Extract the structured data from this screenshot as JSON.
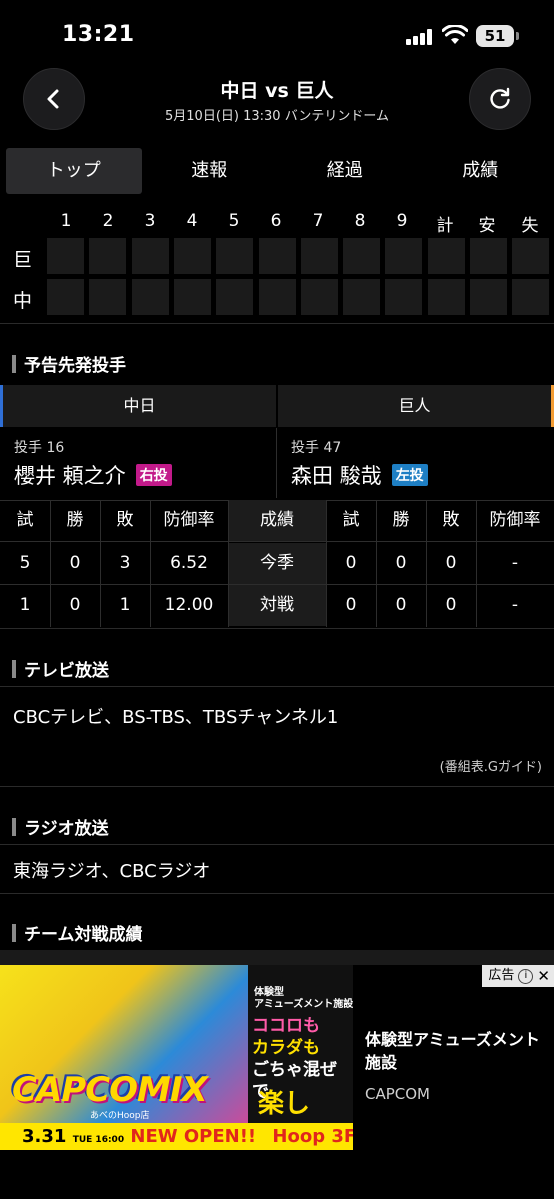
{
  "status": {
    "time": "13:21",
    "battery": "51"
  },
  "header": {
    "title": "中日 vs 巨人",
    "subtitle": "5月10日(日) 13:30 バンテリンドーム"
  },
  "tabs": [
    "トップ",
    "速報",
    "経過",
    "成績"
  ],
  "scoreboard": {
    "columns": [
      "1",
      "2",
      "3",
      "4",
      "5",
      "6",
      "7",
      "8",
      "9",
      "計",
      "安",
      "失"
    ],
    "teams": [
      "巨",
      "中"
    ]
  },
  "starters": {
    "section_title": "予告先発投手",
    "home": {
      "team": "中日",
      "number_label": "投手 16",
      "name": "櫻井 頼之介",
      "hand": "右投"
    },
    "away": {
      "team": "巨人",
      "number_label": "投手 47",
      "name": "森田 駿哉",
      "hand": "左投"
    },
    "headers": [
      "試",
      "勝",
      "敗",
      "防御率",
      "成績",
      "試",
      "勝",
      "敗",
      "防御率"
    ],
    "rows": [
      {
        "label": "今季",
        "home": [
          "5",
          "0",
          "3",
          "6.52"
        ],
        "away": [
          "0",
          "0",
          "0",
          "-"
        ]
      },
      {
        "label": "対戦",
        "home": [
          "1",
          "0",
          "1",
          "12.00"
        ],
        "away": [
          "0",
          "0",
          "0",
          "-"
        ]
      }
    ]
  },
  "tv": {
    "title": "テレビ放送",
    "text": "CBCテレビ、BS-TBS、TBSチャンネル1",
    "note": "(番組表.Gガイド)"
  },
  "radio": {
    "title": "ラジオ放送",
    "text": "東海ラジオ、CBCラジオ"
  },
  "team_record": {
    "title": "チーム対戦成績"
  },
  "ad": {
    "badge": "広告",
    "title": "体験型アミューズメント施設",
    "brand": "CAPCOM",
    "logo": "CAPCOMIX",
    "shop": "あべのHoop店",
    "tag1": "体験型\nアミューズメント施設",
    "tag2a": "ココロも",
    "tag2b": "カラダも",
    "tag2c": "ごちゃ混ぜで",
    "tag3": "楽しめ!!",
    "bottom_date": "3.31",
    "bottom_time": "TUE 16:00",
    "bottom_open": "NEW OPEN!!",
    "bottom_place": "Hoop 3F"
  }
}
